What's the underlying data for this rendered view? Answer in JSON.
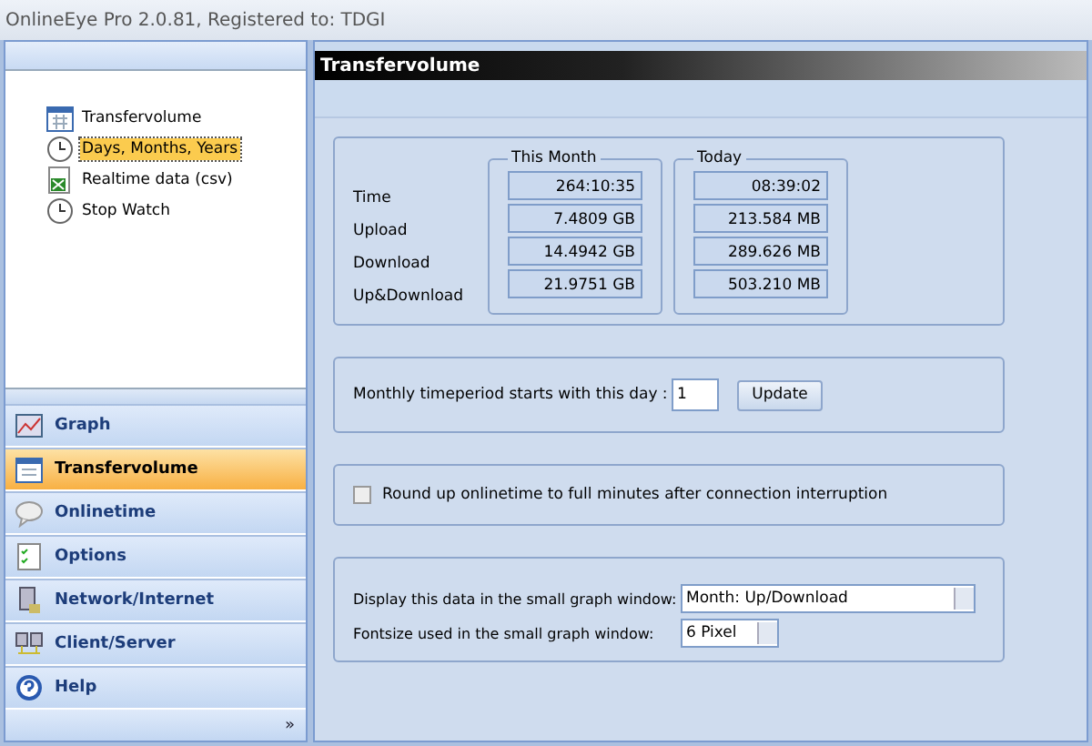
{
  "window": {
    "title": "OnlineEye Pro 2.0.81, Registered to: TDGI"
  },
  "tree": [
    {
      "label": "Transfervolume",
      "selected": false
    },
    {
      "label": "Days, Months, Years",
      "selected": true
    },
    {
      "label": "Realtime data (csv)",
      "selected": false
    },
    {
      "label": "Stop Watch",
      "selected": false
    }
  ],
  "nav": [
    {
      "label": "Graph",
      "selected": false
    },
    {
      "label": "Transfervolume",
      "selected": true
    },
    {
      "label": "Onlinetime",
      "selected": false
    },
    {
      "label": "Options",
      "selected": false
    },
    {
      "label": "Network/Internet",
      "selected": false
    },
    {
      "label": "Client/Server",
      "selected": false
    },
    {
      "label": "Help",
      "selected": false
    }
  ],
  "nav_more": "»",
  "header": "Transfervolume",
  "stats": {
    "row_labels": [
      "Time",
      "Upload",
      "Download",
      "Up&Download"
    ],
    "groups": [
      {
        "title": "This Month",
        "values": [
          "264:10:35",
          "7.4809 GB",
          "14.4942 GB",
          "21.9751 GB"
        ]
      },
      {
        "title": "Today",
        "values": [
          "08:39:02",
          "213.584 MB",
          "289.626 MB",
          "503.210 MB"
        ]
      }
    ]
  },
  "period": {
    "label": "Monthly timeperiod starts with this day :",
    "value": "1",
    "button": "Update"
  },
  "roundup": {
    "label": "Round up onlinetime to full minutes after connection interruption",
    "checked": false
  },
  "graph_settings": [
    {
      "label": "Display this data in the small graph window:",
      "value": "Month: Up/Download"
    },
    {
      "label": "Fontsize used in the small graph window:",
      "value": "6 Pixel"
    }
  ]
}
